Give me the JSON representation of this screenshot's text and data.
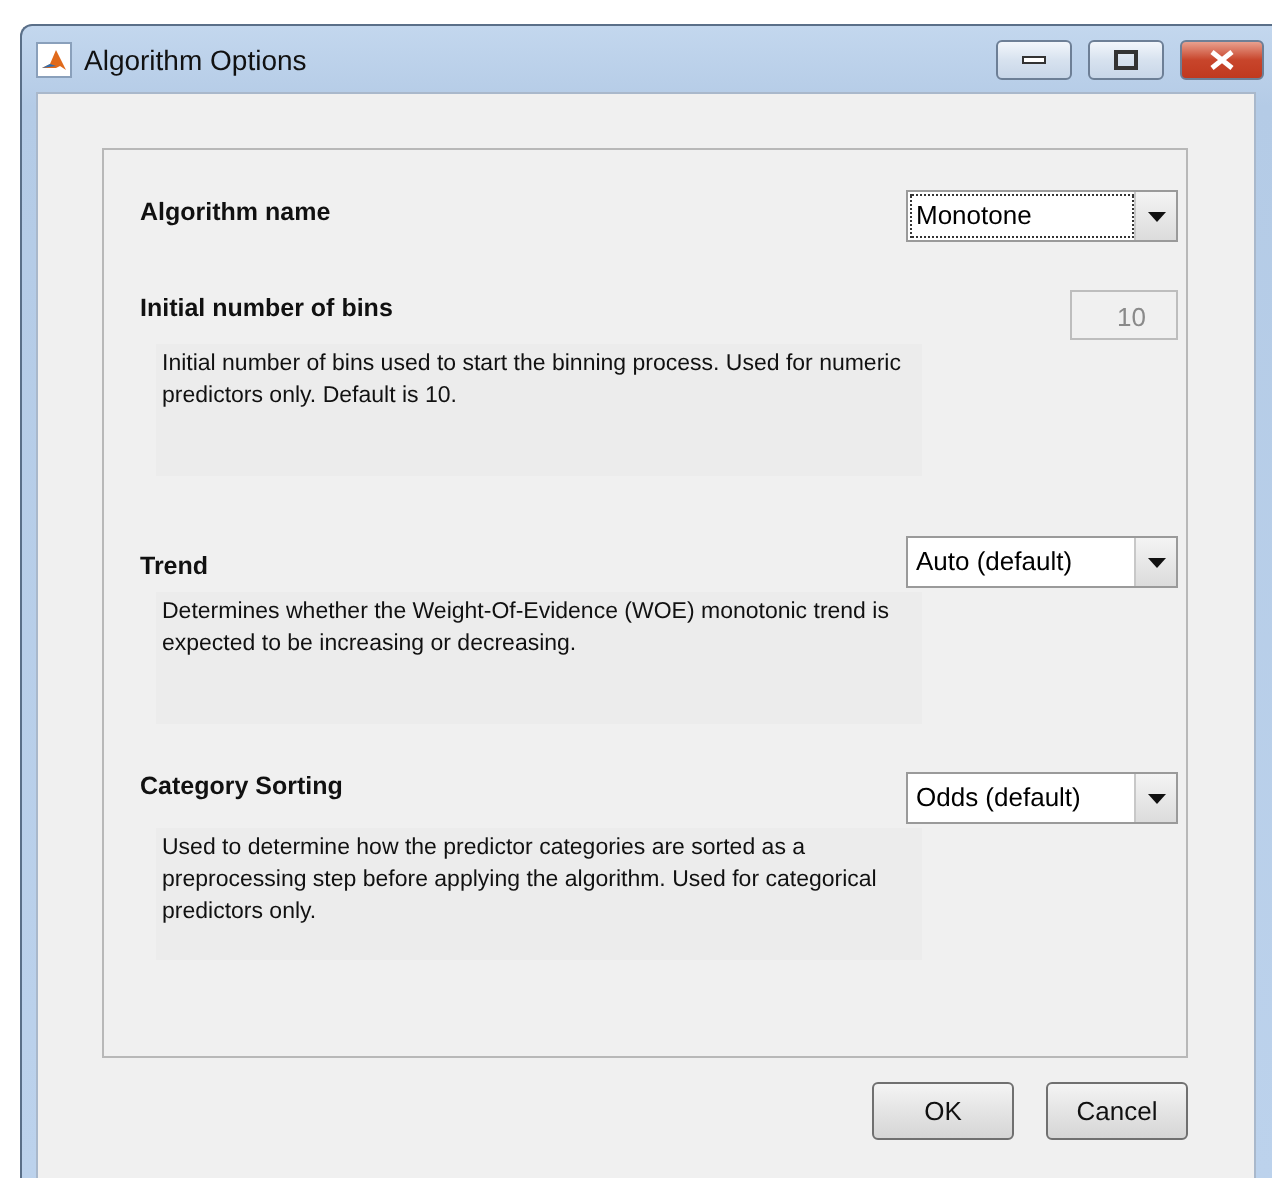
{
  "window": {
    "title": "Algorithm Options"
  },
  "options": [
    {
      "label": "Algorithm name",
      "control": {
        "kind": "dropdown",
        "value": "Monotone",
        "focused": true
      }
    },
    {
      "label": "Initial number of bins",
      "control": {
        "kind": "number",
        "value": "10",
        "disabled": true
      },
      "description": "Initial number of bins used to start the binning process. Used for numeric predictors only. Default is 10."
    },
    {
      "label": "Trend",
      "control": {
        "kind": "dropdown",
        "value": "Auto (default)",
        "focused": false
      },
      "description": "Determines whether the Weight-Of-Evidence (WOE) monotonic trend is expected to be increasing or decreasing."
    },
    {
      "label": "Category Sorting",
      "control": {
        "kind": "dropdown",
        "value": "Odds (default)",
        "focused": false
      },
      "description": "Used to determine how the predictor categories are sorted as a preprocessing step before applying the algorithm. Used for categorical predictors only."
    }
  ],
  "buttons": [
    "OK",
    "Cancel"
  ]
}
